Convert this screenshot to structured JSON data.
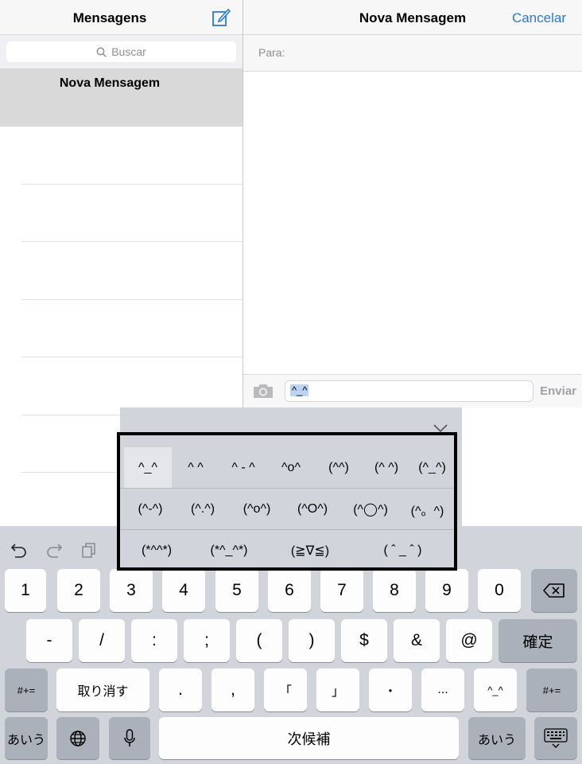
{
  "left_pane": {
    "title": "Mensagens",
    "search_placeholder": "Buscar",
    "selected_item": "Nova Mensagem"
  },
  "right_pane": {
    "title": "Nova Mensagem",
    "cancel_label": "Cancelar",
    "to_label": "Para:",
    "message_text": "^_^",
    "send_label": "Enviar"
  },
  "candidates": {
    "row1": [
      "^_^",
      "^ ^",
      "^ - ^",
      "^o^",
      "(^^)",
      "(^ ^)",
      "(^_^)"
    ],
    "row2": [
      "(^-^)",
      "(^.^)",
      "(^o^)",
      "(^O^)",
      "(^◯^)",
      "(^。^)"
    ],
    "row3": [
      "(*^^*)",
      "(*^_^*)",
      "(≧∇≦)",
      "( ˆ _ ˆ )"
    ]
  },
  "keyboard": {
    "row1": [
      "1",
      "2",
      "3",
      "4",
      "5",
      "6",
      "7",
      "8",
      "9",
      "0"
    ],
    "row2": [
      "-",
      "/",
      ":",
      ";",
      "(",
      ")",
      "$",
      "&",
      "@"
    ],
    "confirm": "確定",
    "row3": {
      "symbols": "#+=",
      "undo": "取り消す",
      "keys": [
        ".",
        ",",
        "「",
        "」",
        "・",
        "...",
        "^_^"
      ],
      "symbols_right": "#+="
    },
    "row4": {
      "kana_left": "あいう",
      "space": "次候補",
      "kana_right": "あいう"
    }
  },
  "colors": {
    "accent": "#2a7ad5",
    "keyboard_bg": "#d1d5db",
    "selected_row": "#d9d9d9"
  },
  "icons": [
    "compose-icon",
    "search-icon",
    "camera-icon",
    "undo-icon",
    "redo-icon",
    "paste-icon",
    "chevron-down-icon",
    "delete-icon",
    "globe-icon",
    "microphone-icon",
    "keyboard-dismiss-icon"
  ]
}
